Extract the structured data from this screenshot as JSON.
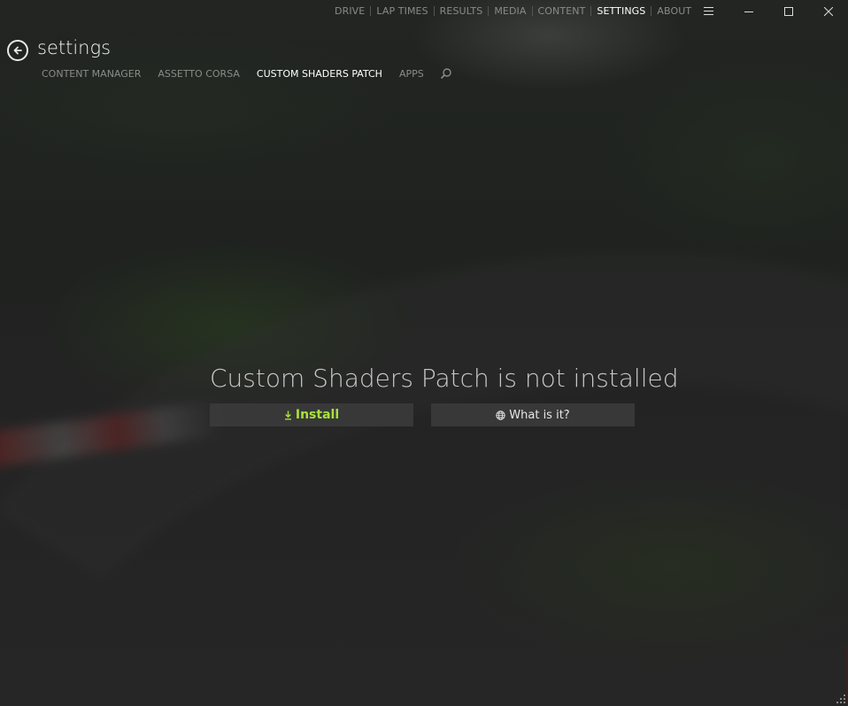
{
  "window": {
    "top_nav": [
      {
        "label": "DRIVE",
        "active": false
      },
      {
        "label": "LAP TIMES",
        "active": false
      },
      {
        "label": "RESULTS",
        "active": false
      },
      {
        "label": "MEDIA",
        "active": false
      },
      {
        "label": "CONTENT",
        "active": false
      },
      {
        "label": "SETTINGS",
        "active": true
      },
      {
        "label": "ABOUT",
        "active": false
      }
    ],
    "controls": {
      "menu_icon": "hamburger-icon",
      "minimize_icon": "minimize-icon",
      "maximize_icon": "maximize-icon",
      "close_icon": "close-icon"
    }
  },
  "header": {
    "back_icon": "arrow-left-circle-icon",
    "title": "settings",
    "tabs": [
      {
        "label": "CONTENT MANAGER",
        "active": false
      },
      {
        "label": "ASSETTO CORSA",
        "active": false
      },
      {
        "label": "CUSTOM SHADERS PATCH",
        "active": true
      },
      {
        "label": "APPS",
        "active": false
      }
    ],
    "search_icon": "search-icon"
  },
  "main": {
    "message": "Custom Shaders Patch is not installed",
    "install_button": {
      "icon": "download-icon",
      "label": "Install"
    },
    "info_button": {
      "icon": "globe-icon",
      "label": "What is it?"
    }
  },
  "colors": {
    "accent": "#a7e33a",
    "active_text": "#ffffff",
    "inactive_text": "#8a8a8a"
  }
}
